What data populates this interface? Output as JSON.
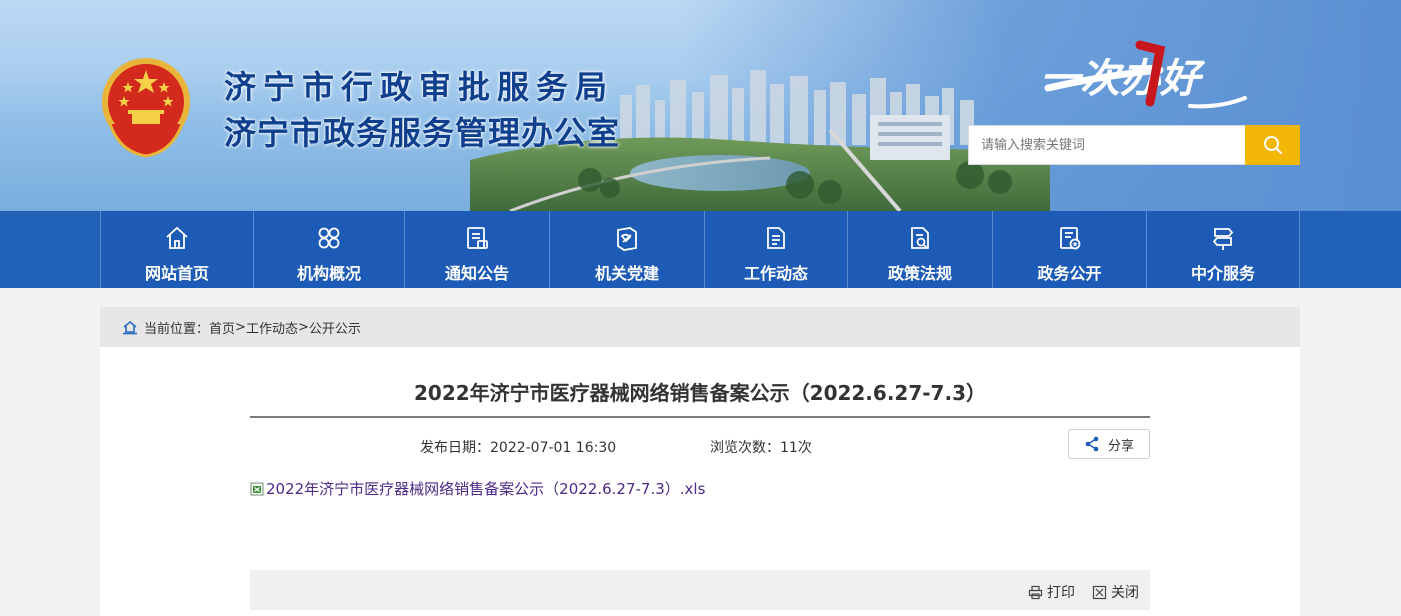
{
  "header": {
    "title_line1": "济宁市行政审批服务局",
    "title_line2": "济宁市政务服务管理办公室",
    "slogan": "一次办好",
    "search_placeholder": "请输入搜索关键词"
  },
  "nav": {
    "items": [
      {
        "label": "网站首页",
        "icon": "home-icon"
      },
      {
        "label": "机构概况",
        "icon": "grid-icon"
      },
      {
        "label": "通知公告",
        "icon": "notice-icon"
      },
      {
        "label": "机关党建",
        "icon": "party-icon"
      },
      {
        "label": "工作动态",
        "icon": "document-icon"
      },
      {
        "label": "政策法规",
        "icon": "policy-icon"
      },
      {
        "label": "政务公开",
        "icon": "public-icon"
      },
      {
        "label": "中介服务",
        "icon": "signpost-icon"
      }
    ]
  },
  "breadcrumb": {
    "prefix": "当前位置：",
    "items": [
      "首页",
      "工作动态",
      "公开公示"
    ],
    "separator": ">"
  },
  "article": {
    "title": "2022年济宁市医疗器械网络销售备案公示（2022.6.27-7.3）",
    "publish_label": "发布日期：",
    "publish_date": "2022-07-01 16:30",
    "views_label": "浏览次数：",
    "views": "11次",
    "share_label": "分享",
    "attachment": "2022年济宁市医疗器械网络销售备案公示（2022.6.27-7.3）.xls",
    "print_label": "打印",
    "close_label": "关闭"
  },
  "colors": {
    "nav_blue": "#1d5bb6",
    "title_blue": "#0f3f8d",
    "search_button": "#f2b707",
    "link_purple": "#4c2a86"
  }
}
